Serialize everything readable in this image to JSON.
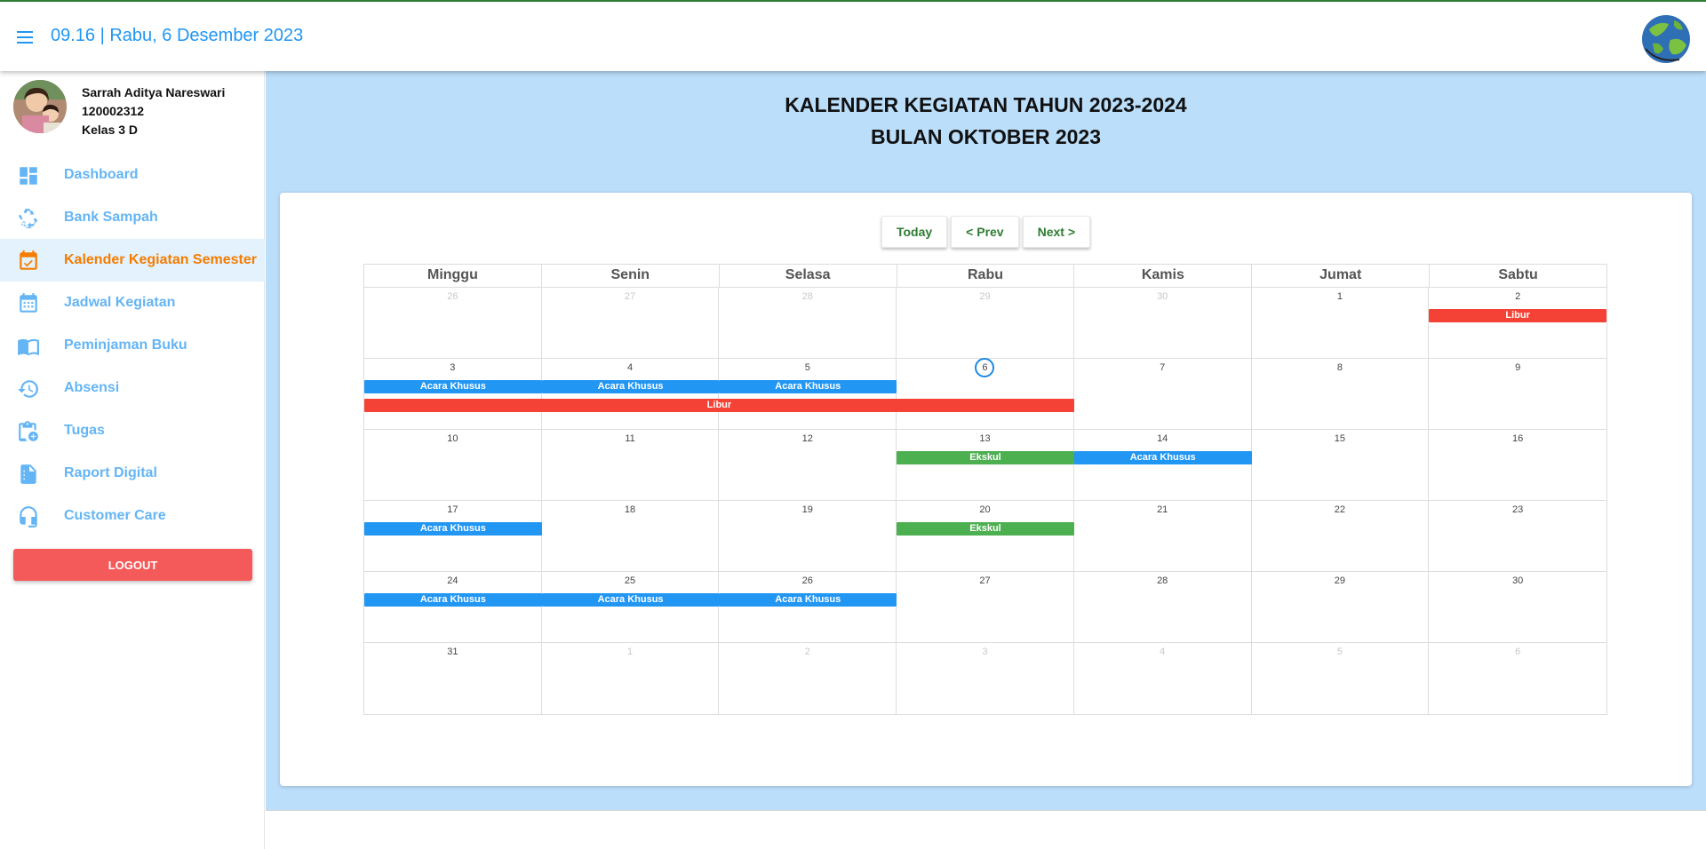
{
  "header": {
    "title": "09.16 | Rabu, 6 Desember 2023",
    "menu_icon": "menu-icon",
    "logo_icon": "school-logo-globe-icon"
  },
  "profile": {
    "name": "Sarrah Aditya Nareswari",
    "id": "120002312",
    "class": "Kelas 3 D"
  },
  "sidebar": {
    "items": [
      {
        "label": "Dashboard",
        "icon": "dashboard-icon"
      },
      {
        "label": "Bank Sampah",
        "icon": "recycle-icon"
      },
      {
        "label": "Kalender Kegiatan Semester",
        "icon": "calendar-check-icon",
        "active": true
      },
      {
        "label": "Jadwal Kegiatan",
        "icon": "calendar-grid-icon"
      },
      {
        "label": "Peminjaman Buku",
        "icon": "book-icon"
      },
      {
        "label": "Absensi",
        "icon": "history-clock-icon"
      },
      {
        "label": "Tugas",
        "icon": "clipboard-plus-icon"
      },
      {
        "label": "Raport Digital",
        "icon": "document-icon"
      },
      {
        "label": "Customer Care",
        "icon": "headset-icon"
      }
    ],
    "logout": "LOGOUT"
  },
  "main": {
    "title_line1": "KALENDER KEGIATAN TAHUN 2023-2024",
    "title_line2": "BULAN OKTOBER 2023"
  },
  "calendar": {
    "buttons": {
      "today": "Today",
      "prev": "< Prev",
      "next": "Next >"
    },
    "weekdays": [
      "Minggu",
      "Senin",
      "Selasa",
      "Rabu",
      "Kamis",
      "Jumat",
      "Sabtu"
    ],
    "weeks": [
      {
        "days": [
          "26",
          "27",
          "28",
          "29",
          "30",
          "1",
          "2"
        ],
        "other": [
          true,
          true,
          true,
          true,
          true,
          false,
          false
        ]
      },
      {
        "days": [
          "3",
          "4",
          "5",
          "6",
          "7",
          "8",
          "9"
        ],
        "other": [
          false,
          false,
          false,
          false,
          false,
          false,
          false
        ],
        "today": 3
      },
      {
        "days": [
          "10",
          "11",
          "12",
          "13",
          "14",
          "15",
          "16"
        ],
        "other": [
          false,
          false,
          false,
          false,
          false,
          false,
          false
        ]
      },
      {
        "days": [
          "17",
          "18",
          "19",
          "20",
          "21",
          "22",
          "23"
        ],
        "other": [
          false,
          false,
          false,
          false,
          false,
          false,
          false
        ]
      },
      {
        "days": [
          "24",
          "25",
          "26",
          "27",
          "28",
          "29",
          "30"
        ],
        "other": [
          false,
          false,
          false,
          false,
          false,
          false,
          false
        ]
      },
      {
        "days": [
          "31",
          "1",
          "2",
          "3",
          "4",
          "5",
          "6"
        ],
        "other": [
          false,
          true,
          true,
          true,
          true,
          true,
          true
        ]
      }
    ],
    "events": [
      {
        "week": 0,
        "start": 6,
        "span": 1,
        "row": 0,
        "label": "Libur",
        "color": "#f44336"
      },
      {
        "week": 1,
        "start": 0,
        "span": 1,
        "row": 0,
        "label": "Acara Khusus",
        "color": "#2196f3"
      },
      {
        "week": 1,
        "start": 1,
        "span": 1,
        "row": 0,
        "label": "Acara Khusus",
        "color": "#2196f3"
      },
      {
        "week": 1,
        "start": 2,
        "span": 1,
        "row": 0,
        "label": "Acara Khusus",
        "color": "#2196f3"
      },
      {
        "week": 1,
        "start": 0,
        "span": 4,
        "row": 1,
        "label": "Libur",
        "color": "#f44336"
      },
      {
        "week": 2,
        "start": 3,
        "span": 1,
        "row": 0,
        "label": "Ekskul",
        "color": "#4caf50"
      },
      {
        "week": 2,
        "start": 4,
        "span": 1,
        "row": 0,
        "label": "Acara Khusus",
        "color": "#2196f3"
      },
      {
        "week": 3,
        "start": 0,
        "span": 1,
        "row": 0,
        "label": "Acara Khusus",
        "color": "#2196f3"
      },
      {
        "week": 3,
        "start": 3,
        "span": 1,
        "row": 0,
        "label": "Ekskul",
        "color": "#4caf50"
      },
      {
        "week": 4,
        "start": 0,
        "span": 1,
        "row": 0,
        "label": "Acara Khusus",
        "color": "#2196f3"
      },
      {
        "week": 4,
        "start": 1,
        "span": 1,
        "row": 0,
        "label": "Acara Khusus",
        "color": "#2196f3"
      },
      {
        "week": 4,
        "start": 2,
        "span": 1,
        "row": 0,
        "label": "Acara Khusus",
        "color": "#2196f3"
      }
    ]
  },
  "colors": {
    "accent": "#2196f3",
    "active": "#f57c00",
    "sidebar_text": "#64b5f6",
    "main_bg": "#bbdefb",
    "logout": "#f55a5a"
  }
}
